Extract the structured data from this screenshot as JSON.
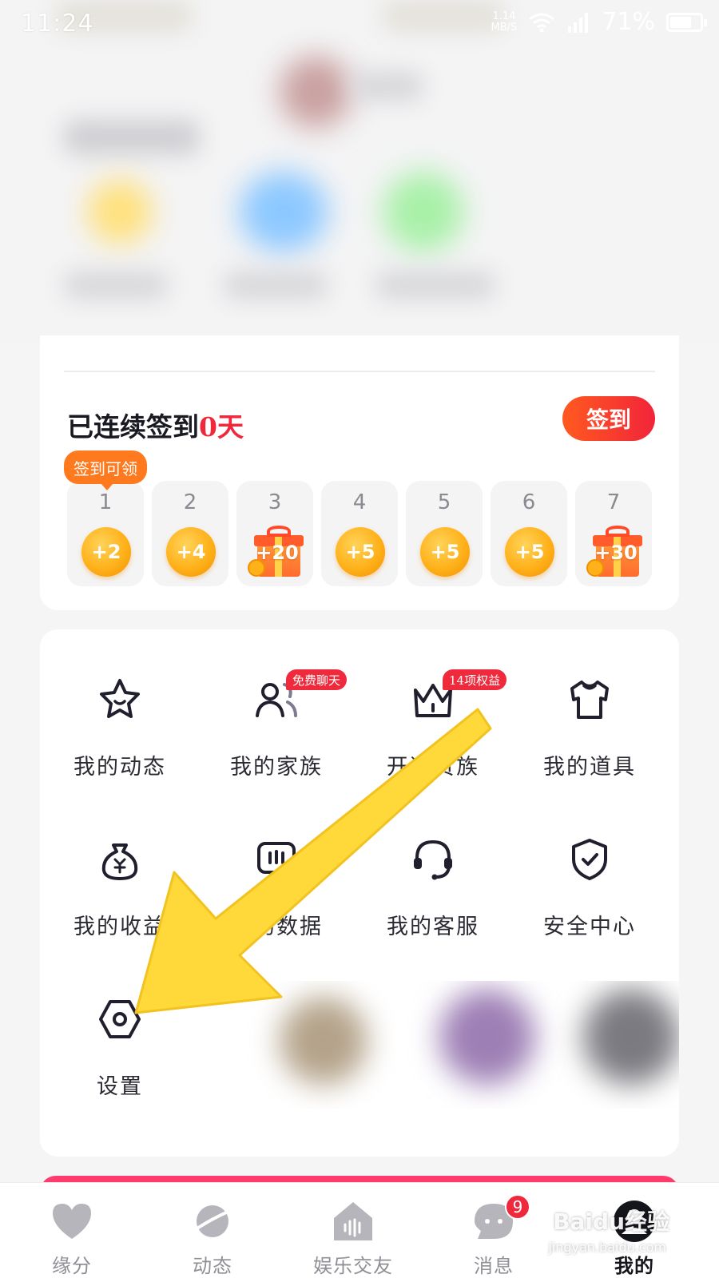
{
  "status_bar": {
    "time": "11:24",
    "net_speed_value": "1.14",
    "net_speed_unit": "MB/S",
    "battery_percent": "71%",
    "battery_level": 0.71
  },
  "signin": {
    "streak_prefix": "已连续签到",
    "streak_count": "0天",
    "button_label": "签到",
    "reward_tip": "签到可领",
    "days": [
      {
        "day": "1",
        "reward": "+2",
        "type": "coin"
      },
      {
        "day": "2",
        "reward": "+4",
        "type": "coin"
      },
      {
        "day": "3",
        "reward": "+20",
        "type": "gift"
      },
      {
        "day": "4",
        "reward": "+5",
        "type": "coin"
      },
      {
        "day": "5",
        "reward": "+5",
        "type": "coin"
      },
      {
        "day": "6",
        "reward": "+5",
        "type": "coin"
      },
      {
        "day": "7",
        "reward": "+30",
        "type": "gift"
      }
    ]
  },
  "menu": {
    "items": [
      {
        "label": "我的动态",
        "icon": "star-icon"
      },
      {
        "label": "我的家族",
        "icon": "family-icon",
        "badge": "免费聊天"
      },
      {
        "label": "开通贵族",
        "icon": "crown-icon",
        "badge": "14项权益"
      },
      {
        "label": "我的道具",
        "icon": "shirt-icon"
      },
      {
        "label": "我的收益",
        "icon": "money-bag-icon"
      },
      {
        "label": "我的数据",
        "icon": "data-icon"
      },
      {
        "label": "我的客服",
        "icon": "headset-icon"
      },
      {
        "label": "安全中心",
        "icon": "shield-icon"
      },
      {
        "label": "设置",
        "icon": "settings-hex-icon"
      }
    ]
  },
  "bottom_nav": {
    "items": [
      {
        "label": "缘分",
        "icon": "heart-icon"
      },
      {
        "label": "动态",
        "icon": "planet-icon"
      },
      {
        "label": "娱乐交友",
        "icon": "house-audio-icon"
      },
      {
        "label": "消息",
        "icon": "chat-bubble-icon",
        "badge": "9"
      },
      {
        "label": "我的",
        "icon": "user-avatar-icon"
      }
    ],
    "active": "我的"
  },
  "watermark": {
    "brand": "Baidu经验",
    "url": "jingyan.baidu.com"
  },
  "colors": {
    "accent_red": "#f0283c",
    "accent_orange": "#ff7a1e",
    "arrow_yellow": "#ffd83a",
    "coin_gold": "#ffb11a"
  }
}
